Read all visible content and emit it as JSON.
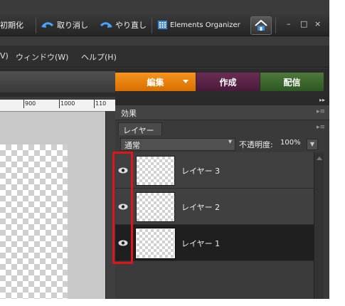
{
  "toolbar": {
    "reset_label": "初期化",
    "undo_label": "取り消し",
    "redo_label": "やり直し",
    "organizer_label": "Elements Organizer",
    "home_icon": "home-icon",
    "min_label": "–",
    "max_label": "□",
    "close_label": "×"
  },
  "menubar": {
    "items": [
      "V)",
      "ウィンドウ(W)",
      "ヘルプ(H)"
    ]
  },
  "mode_tabs": [
    {
      "label": "編集",
      "color": "#f7941d"
    },
    {
      "label": "作成",
      "color": "#5a2447"
    },
    {
      "label": "配信",
      "color": "#3d6a2e"
    }
  ],
  "ruler": {
    "ticks": [
      "900",
      "1000",
      "110"
    ]
  },
  "panels": {
    "top_arrow": "▸▸",
    "effects_label": "効果",
    "layers_label": "レイヤー",
    "blend_mode": "通常",
    "opacity_label": "不透明度:",
    "opacity_value": "100%"
  },
  "layers": [
    {
      "name": "レイヤー 3",
      "visible": true,
      "selected": false
    },
    {
      "name": "レイヤー 2",
      "visible": true,
      "selected": false
    },
    {
      "name": "レイヤー 1",
      "visible": true,
      "selected": true
    }
  ],
  "highlight_color": "#e0151b"
}
